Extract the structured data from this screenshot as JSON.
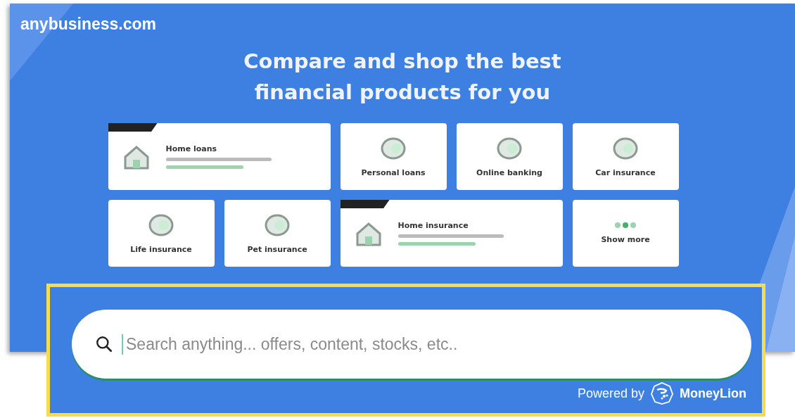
{
  "site": {
    "domain": "anybusiness.com"
  },
  "hero": {
    "heading_lines": [
      "Compare and shop the best",
      "financial products for you"
    ]
  },
  "cards": [
    {
      "title": "Home loans",
      "kind": "wide",
      "badge": true
    },
    {
      "title": "Personal loans",
      "kind": "tile",
      "badge": false
    },
    {
      "title": "Online banking",
      "kind": "tile",
      "badge": false
    },
    {
      "title": "Car insurance",
      "kind": "tile",
      "badge": false
    },
    {
      "title": "Life insurance",
      "kind": "tile",
      "badge": false
    },
    {
      "title": "Pet insurance",
      "kind": "tile",
      "badge": false
    },
    {
      "title": "Home insurance",
      "kind": "wide",
      "badge": true
    },
    {
      "title": "Show more",
      "kind": "more",
      "badge": false
    }
  ],
  "search": {
    "placeholder": "Search anything... offers, content, stocks, etc.."
  },
  "powered_by": {
    "label": "Powered by",
    "brand": "MoneyLion"
  }
}
